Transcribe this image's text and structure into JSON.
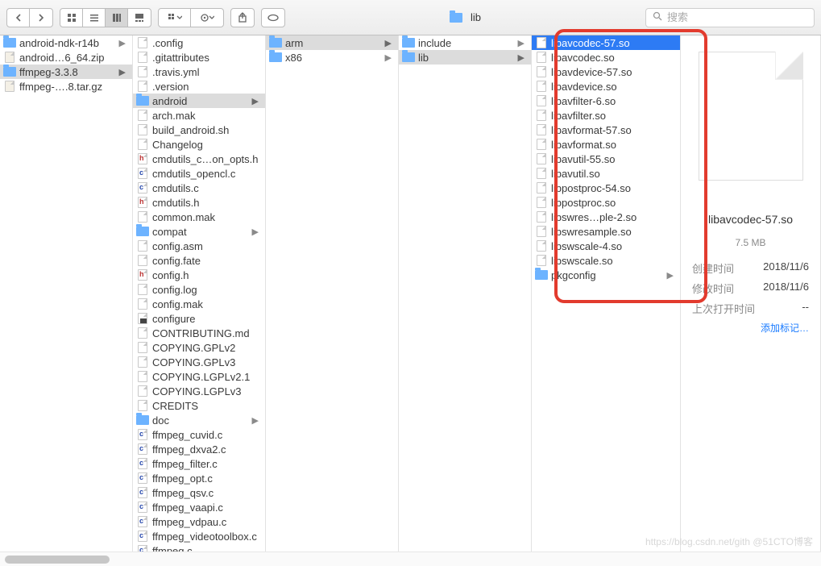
{
  "toolbar": {
    "path_label": "lib",
    "search_placeholder": "搜索"
  },
  "columns": [
    {
      "id": "root",
      "items": [
        {
          "name": "android-ndk-r14b",
          "type": "folder",
          "expandable": true
        },
        {
          "name": "android…6_64.zip",
          "type": "zip"
        },
        {
          "name": "ffmpeg-3.3.8",
          "type": "folder",
          "expandable": true,
          "selected": true
        },
        {
          "name": "ffmpeg-….8.tar.gz",
          "type": "zip"
        }
      ]
    },
    {
      "id": "ffmpeg",
      "items": [
        {
          "name": ".config",
          "type": "file"
        },
        {
          "name": ".gitattributes",
          "type": "file"
        },
        {
          "name": ".travis.yml",
          "type": "file"
        },
        {
          "name": ".version",
          "type": "file"
        },
        {
          "name": "android",
          "type": "folder",
          "expandable": true,
          "selected": true
        },
        {
          "name": "arch.mak",
          "type": "file"
        },
        {
          "name": "build_android.sh",
          "type": "file"
        },
        {
          "name": "Changelog",
          "type": "file"
        },
        {
          "name": "cmdutils_c…on_opts.h",
          "type": "h"
        },
        {
          "name": "cmdutils_opencl.c",
          "type": "c"
        },
        {
          "name": "cmdutils.c",
          "type": "c"
        },
        {
          "name": "cmdutils.h",
          "type": "h"
        },
        {
          "name": "common.mak",
          "type": "file"
        },
        {
          "name": "compat",
          "type": "folder",
          "expandable": true
        },
        {
          "name": "config.asm",
          "type": "file"
        },
        {
          "name": "config.fate",
          "type": "file"
        },
        {
          "name": "config.h",
          "type": "h"
        },
        {
          "name": "config.log",
          "type": "file"
        },
        {
          "name": "config.mak",
          "type": "file"
        },
        {
          "name": "configure",
          "type": "exec"
        },
        {
          "name": "CONTRIBUTING.md",
          "type": "file"
        },
        {
          "name": "COPYING.GPLv2",
          "type": "file"
        },
        {
          "name": "COPYING.GPLv3",
          "type": "file"
        },
        {
          "name": "COPYING.LGPLv2.1",
          "type": "file"
        },
        {
          "name": "COPYING.LGPLv3",
          "type": "file"
        },
        {
          "name": "CREDITS",
          "type": "file"
        },
        {
          "name": "doc",
          "type": "folder",
          "expandable": true
        },
        {
          "name": "ffmpeg_cuvid.c",
          "type": "c"
        },
        {
          "name": "ffmpeg_dxva2.c",
          "type": "c"
        },
        {
          "name": "ffmpeg_filter.c",
          "type": "c"
        },
        {
          "name": "ffmpeg_opt.c",
          "type": "c"
        },
        {
          "name": "ffmpeg_qsv.c",
          "type": "c"
        },
        {
          "name": "ffmpeg_vaapi.c",
          "type": "c"
        },
        {
          "name": "ffmpeg_vdpau.c",
          "type": "c"
        },
        {
          "name": "ffmpeg_videotoolbox.c",
          "type": "c"
        },
        {
          "name": "ffmpeg.c",
          "type": "c"
        }
      ]
    },
    {
      "id": "android",
      "items": [
        {
          "name": "arm",
          "type": "folder",
          "expandable": true,
          "selected": true
        },
        {
          "name": "x86",
          "type": "folder",
          "expandable": true
        }
      ]
    },
    {
      "id": "arm",
      "items": [
        {
          "name": "include",
          "type": "folder",
          "expandable": true
        },
        {
          "name": "lib",
          "type": "folder",
          "expandable": true,
          "selected": true
        }
      ]
    },
    {
      "id": "lib",
      "items": [
        {
          "name": "libavcodec-57.so",
          "type": "file",
          "selected": true,
          "blue": true
        },
        {
          "name": "libavcodec.so",
          "type": "file"
        },
        {
          "name": "libavdevice-57.so",
          "type": "file"
        },
        {
          "name": "libavdevice.so",
          "type": "file"
        },
        {
          "name": "libavfilter-6.so",
          "type": "file"
        },
        {
          "name": "libavfilter.so",
          "type": "file"
        },
        {
          "name": "libavformat-57.so",
          "type": "file"
        },
        {
          "name": "libavformat.so",
          "type": "file"
        },
        {
          "name": "libavutil-55.so",
          "type": "file"
        },
        {
          "name": "libavutil.so",
          "type": "file"
        },
        {
          "name": "libpostproc-54.so",
          "type": "file"
        },
        {
          "name": "libpostproc.so",
          "type": "file"
        },
        {
          "name": "libswres…ple-2.so",
          "type": "file"
        },
        {
          "name": "libswresample.so",
          "type": "file"
        },
        {
          "name": "libswscale-4.so",
          "type": "file"
        },
        {
          "name": "libswscale.so",
          "type": "file"
        },
        {
          "name": "pkgconfig",
          "type": "folder",
          "expandable": true
        }
      ]
    }
  ],
  "preview": {
    "filename": "libavcodec-57.so",
    "size": "7.5 MB",
    "created_label": "创建时间",
    "created_value": "2018/11/6",
    "modified_label": "修改时间",
    "modified_value": "2018/11/6",
    "opened_label": "上次打开时间",
    "opened_value": "--",
    "add_tag": "添加标记…"
  },
  "watermark": "https://blog.csdn.net/gith   @51CTO博客"
}
